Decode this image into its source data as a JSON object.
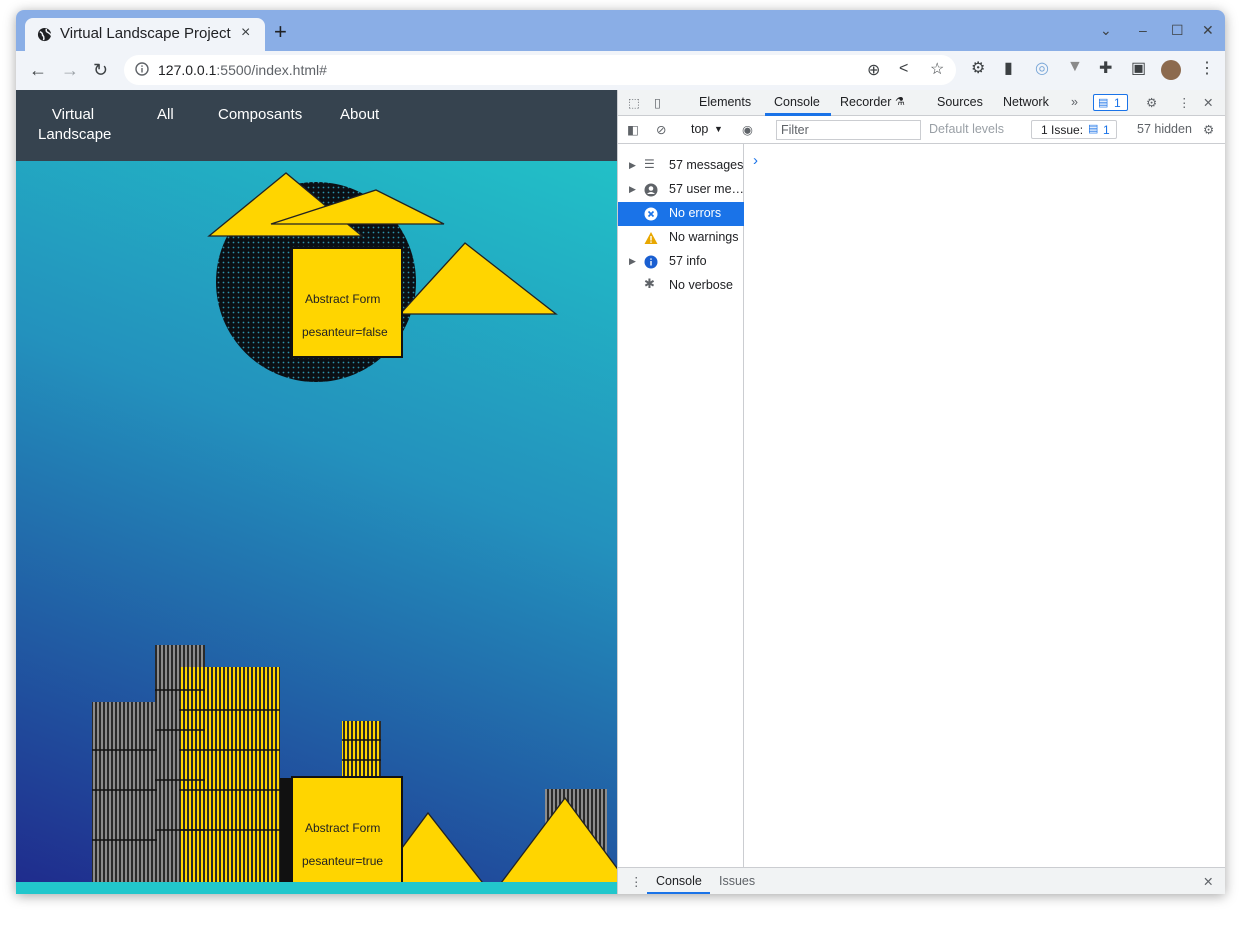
{
  "browser": {
    "tab_title": "Virtual Landscape Project",
    "tab_close": "×",
    "new_tab": "+",
    "url_host": "127.0.0.1",
    "url_rest": ":5500/index.html#"
  },
  "site": {
    "nav": [
      "Virtual Landscape",
      "All",
      "Composants",
      "About"
    ],
    "forms": [
      {
        "title": "Abstract Form",
        "prop": "pesanteur=false"
      },
      {
        "title": "Abstract Form",
        "prop": "pesanteur=true"
      }
    ]
  },
  "devtools": {
    "tabs": [
      "Elements",
      "Console",
      "Recorder",
      "Sources",
      "Network"
    ],
    "issues_badge": "1",
    "context": "top",
    "filter_placeholder": "Filter",
    "levels": "Default levels",
    "issue_chip": "1 Issue:",
    "issue_chip_count": "1",
    "hidden": "57 hidden",
    "sidebar": [
      "57 messages",
      "57 user me…",
      "No errors",
      "No warnings",
      "57 info",
      "No verbose"
    ],
    "bottom_tabs": [
      "Console",
      "Issues"
    ],
    "prompt": "›"
  },
  "colors": {
    "accent": "#1a73e8",
    "nav_bg": "#36434f",
    "shape_yellow": "#ffd500"
  }
}
